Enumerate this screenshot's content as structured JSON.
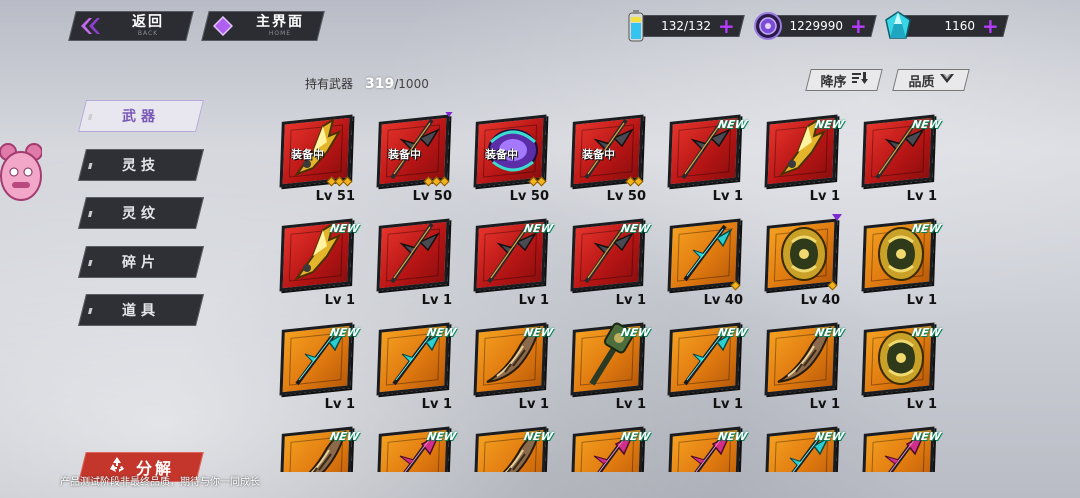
{
  "nav": {
    "back": {
      "label": "返回",
      "sub": "BACK"
    },
    "home": {
      "label": "主界面",
      "sub": "HOME"
    }
  },
  "resources": {
    "stamina": {
      "value": "132/132",
      "icon": "battery-icon"
    },
    "coins": {
      "value": "1229990",
      "icon": "coin-icon"
    },
    "gems": {
      "value": "1160",
      "icon": "crystal-icon"
    },
    "plus": "+"
  },
  "inventory": {
    "owned_label": "持有武器",
    "count": "319",
    "total": "/1000"
  },
  "sort": {
    "order_label": "降序",
    "order_icon": "sort-icon",
    "quality_label": "品质",
    "quality_icon": "chevron-down-icon"
  },
  "tabs": [
    {
      "label": "武器",
      "active": true
    },
    {
      "label": "灵技",
      "active": false
    },
    {
      "label": "灵纹",
      "active": false
    },
    {
      "label": "碎片",
      "active": false
    },
    {
      "label": "道具",
      "active": false
    }
  ],
  "badges": {
    "equipped": "装备中",
    "new": "NEW"
  },
  "cards": [
    {
      "lv": "Lv 51",
      "bg": "red",
      "art": "golden-blade",
      "equipped": true,
      "new": false,
      "stars": 3,
      "flag": false
    },
    {
      "lv": "Lv 50",
      "bg": "red",
      "art": "dark-spear",
      "equipped": true,
      "new": false,
      "stars": 3,
      "flag": true
    },
    {
      "lv": "Lv 50",
      "bg": "red",
      "art": "purple-orb",
      "equipped": true,
      "new": false,
      "stars": 2,
      "flag": false
    },
    {
      "lv": "Lv 50",
      "bg": "red",
      "art": "dark-spear",
      "equipped": true,
      "new": false,
      "stars": 2,
      "flag": false
    },
    {
      "lv": "Lv 1",
      "bg": "red",
      "art": "dark-spear",
      "equipped": false,
      "new": true,
      "stars": 0,
      "flag": false
    },
    {
      "lv": "Lv 1",
      "bg": "red",
      "art": "golden-blade",
      "equipped": false,
      "new": true,
      "stars": 0,
      "flag": false
    },
    {
      "lv": "Lv 1",
      "bg": "red",
      "art": "dark-spear",
      "equipped": false,
      "new": true,
      "stars": 0,
      "flag": false
    },
    {
      "lv": "Lv 1",
      "bg": "red",
      "art": "golden-blade",
      "equipped": false,
      "new": true,
      "stars": 0,
      "flag": false
    },
    {
      "lv": "Lv 1",
      "bg": "red",
      "art": "dark-spear",
      "equipped": false,
      "new": false,
      "stars": 0,
      "flag": false
    },
    {
      "lv": "Lv 1",
      "bg": "red",
      "art": "dark-spear",
      "equipped": false,
      "new": true,
      "stars": 0,
      "flag": false
    },
    {
      "lv": "Lv 1",
      "bg": "red",
      "art": "dark-spear",
      "equipped": false,
      "new": true,
      "stars": 0,
      "flag": false
    },
    {
      "lv": "Lv 40",
      "bg": "orange",
      "art": "cyan-spear",
      "equipped": false,
      "new": false,
      "stars": 1,
      "flag": false
    },
    {
      "lv": "Lv 40",
      "bg": "orange",
      "art": "gold-orb",
      "equipped": false,
      "new": false,
      "stars": 1,
      "flag": true
    },
    {
      "lv": "Lv 1",
      "bg": "orange",
      "art": "gold-orb",
      "equipped": false,
      "new": true,
      "stars": 0,
      "flag": false
    },
    {
      "lv": "Lv 1",
      "bg": "orange",
      "art": "cyan-spear",
      "equipped": false,
      "new": true,
      "stars": 0,
      "flag": false
    },
    {
      "lv": "Lv 1",
      "bg": "orange",
      "art": "cyan-spear",
      "equipped": false,
      "new": true,
      "stars": 0,
      "flag": false
    },
    {
      "lv": "Lv 1",
      "bg": "orange",
      "art": "claw-blade",
      "equipped": false,
      "new": true,
      "stars": 0,
      "flag": false
    },
    {
      "lv": "Lv 1",
      "bg": "orange",
      "art": "green-hammer",
      "equipped": false,
      "new": true,
      "stars": 0,
      "flag": false
    },
    {
      "lv": "Lv 1",
      "bg": "orange",
      "art": "cyan-spear",
      "equipped": false,
      "new": true,
      "stars": 0,
      "flag": false
    },
    {
      "lv": "Lv 1",
      "bg": "orange",
      "art": "claw-blade",
      "equipped": false,
      "new": true,
      "stars": 0,
      "flag": false
    },
    {
      "lv": "Lv 1",
      "bg": "orange",
      "art": "gold-orb",
      "equipped": false,
      "new": true,
      "stars": 0,
      "flag": false
    },
    {
      "lv": "",
      "bg": "orange",
      "art": "claw-blade",
      "equipped": false,
      "new": true,
      "stars": 0,
      "flag": false
    },
    {
      "lv": "",
      "bg": "orange",
      "art": "pink-spear",
      "equipped": false,
      "new": true,
      "stars": 0,
      "flag": false
    },
    {
      "lv": "",
      "bg": "orange",
      "art": "claw-blade",
      "equipped": false,
      "new": true,
      "stars": 0,
      "flag": false
    },
    {
      "lv": "",
      "bg": "orange",
      "art": "pink-spear",
      "equipped": false,
      "new": true,
      "stars": 0,
      "flag": false
    },
    {
      "lv": "",
      "bg": "orange",
      "art": "pink-spear",
      "equipped": false,
      "new": true,
      "stars": 0,
      "flag": false
    },
    {
      "lv": "",
      "bg": "orange",
      "art": "cyan-spear",
      "equipped": false,
      "new": true,
      "stars": 0,
      "flag": false
    },
    {
      "lv": "",
      "bg": "orange",
      "art": "pink-spear",
      "equipped": false,
      "new": true,
      "stars": 0,
      "flag": false
    }
  ],
  "bottom": {
    "decompose_label": "分解",
    "decompose_icon": "recycle-icon",
    "notice": "产品测试阶段非最终品质，期待与你一同成长"
  }
}
